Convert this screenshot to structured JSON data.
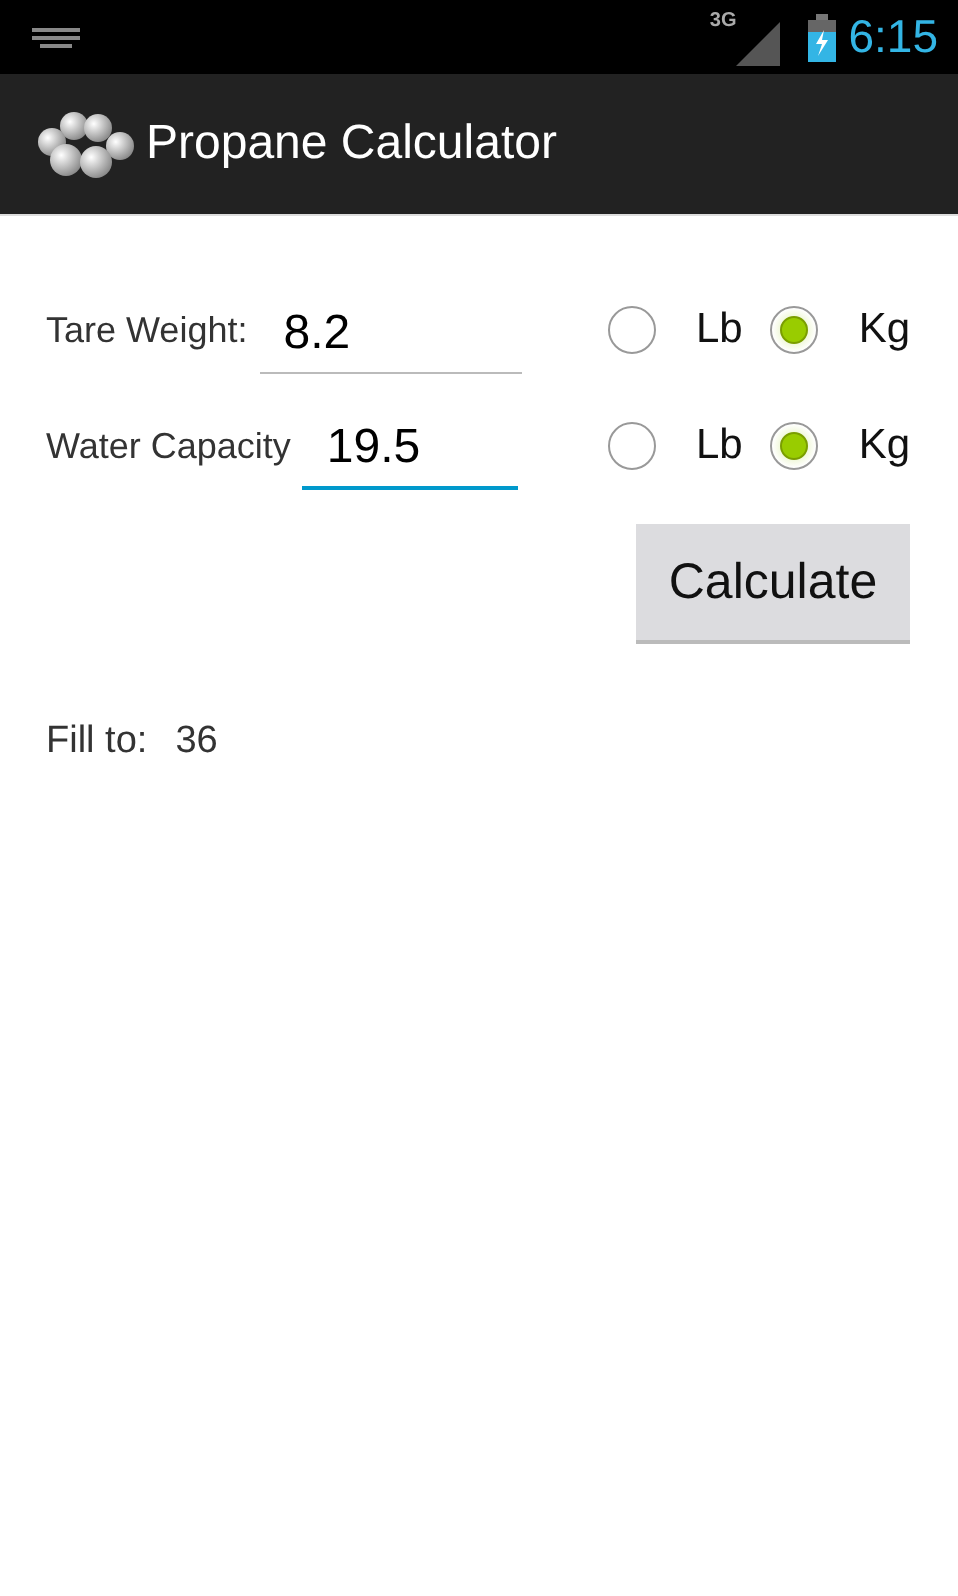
{
  "status_bar": {
    "network": "3G",
    "time": "6:15"
  },
  "action_bar": {
    "title": "Propane Calculator"
  },
  "rows": [
    {
      "label": "Tare Weight:",
      "value": "8.2",
      "focused": false,
      "units": [
        {
          "label": "Lb",
          "selected": false
        },
        {
          "label": "Kg",
          "selected": true
        }
      ]
    },
    {
      "label": "Water Capacity",
      "value": "19.5",
      "focused": true,
      "units": [
        {
          "label": "Lb",
          "selected": false
        },
        {
          "label": "Kg",
          "selected": true
        }
      ]
    }
  ],
  "button": "Calculate",
  "result": {
    "label": "Fill to:",
    "value": "36"
  }
}
